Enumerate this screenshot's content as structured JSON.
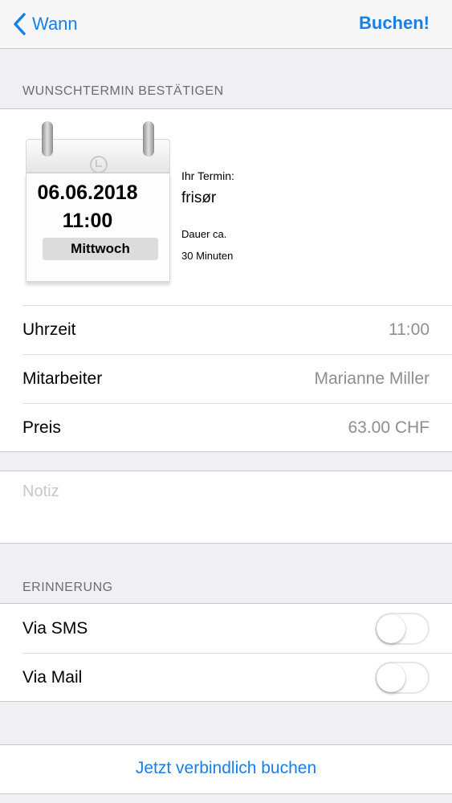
{
  "navbar": {
    "back_label": "Wann",
    "action_label": "Buchen!"
  },
  "confirm_section": {
    "header": "WUNSCHTERMIN BESTÄTIGEN"
  },
  "calendar": {
    "date": "06.06.2018",
    "time": "11:00",
    "weekday": "Mittwoch"
  },
  "appointment": {
    "label": "Ihr Termin:",
    "service": "frisør",
    "duration_label": "Dauer ca.",
    "duration": "30 Minuten"
  },
  "details": [
    {
      "label": "Uhrzeit",
      "value": "11:00"
    },
    {
      "label": "Mitarbeiter",
      "value": "Marianne Miller"
    },
    {
      "label": "Preis",
      "value": "63.00 CHF"
    }
  ],
  "note": {
    "placeholder": "Notiz"
  },
  "reminder_section": {
    "header": "ERINNERUNG",
    "options": [
      {
        "label": "Via SMS",
        "enabled": false
      },
      {
        "label": "Via Mail",
        "enabled": false
      }
    ]
  },
  "submit": {
    "label": "Jetzt verbindlich buchen"
  },
  "colors": {
    "accent": "#1a7ee8",
    "background": "#efeff4",
    "secondary_text": "#8e8e93"
  },
  "icons": {
    "back": "chevron-left-icon",
    "clock": "clock-icon"
  }
}
